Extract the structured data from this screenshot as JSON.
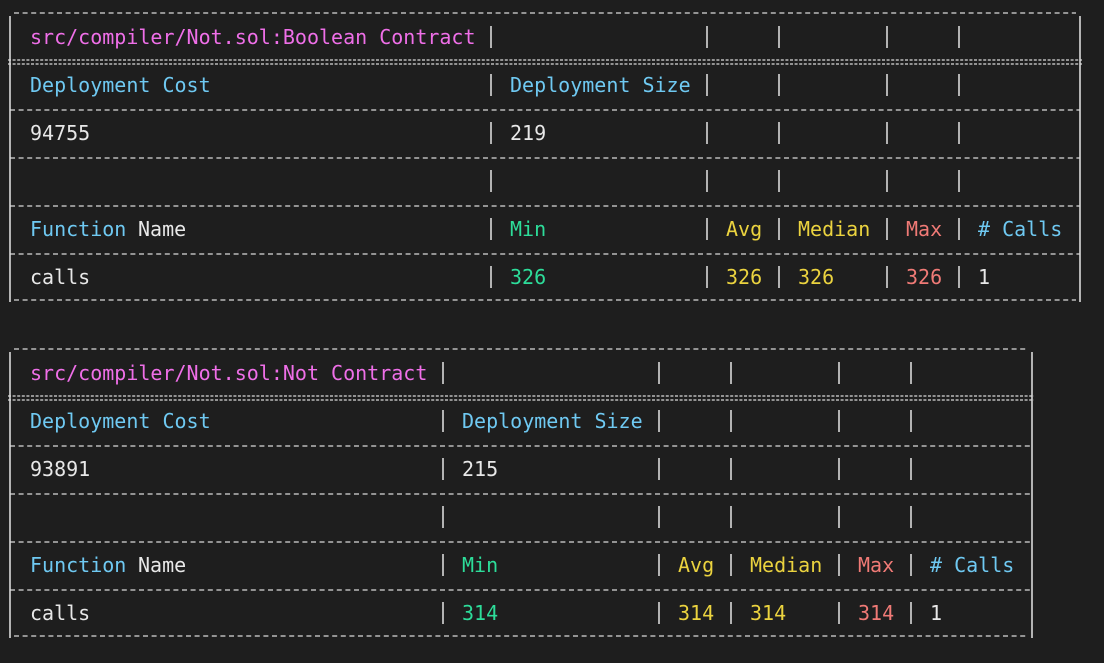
{
  "tables": [
    {
      "contract_name": "src/compiler/Not.sol:Boolean Contract",
      "deployment_cost_label": "Deployment Cost",
      "deployment_size_label": "Deployment Size",
      "deployment_cost": "94755",
      "deployment_size": "219",
      "function_header": {
        "function": "Function",
        "name": "Name",
        "min": "Min",
        "avg": "Avg",
        "median": "Median",
        "max": "Max",
        "calls": "# Calls"
      },
      "rows": [
        {
          "function": "calls",
          "min": "326",
          "avg": "326",
          "median": "326",
          "max": "326",
          "calls": "1"
        }
      ]
    },
    {
      "contract_name": "src/compiler/Not.sol:Not Contract",
      "deployment_cost_label": "Deployment Cost",
      "deployment_size_label": "Deployment Size",
      "deployment_cost": "93891",
      "deployment_size": "215",
      "function_header": {
        "function": "Function",
        "name": "Name",
        "min": "Min",
        "avg": "Avg",
        "median": "Median",
        "max": "Max",
        "calls": "# Calls"
      },
      "rows": [
        {
          "function": "calls",
          "min": "314",
          "avg": "314",
          "median": "314",
          "max": "314",
          "calls": "1"
        }
      ]
    }
  ],
  "colors": {
    "background": "#1e1e1e",
    "contract": "#ef6fe8",
    "header": "#6fc9f2",
    "min": "#2ddd9a",
    "avg_median": "#ebd33f",
    "max": "#f07a76"
  }
}
